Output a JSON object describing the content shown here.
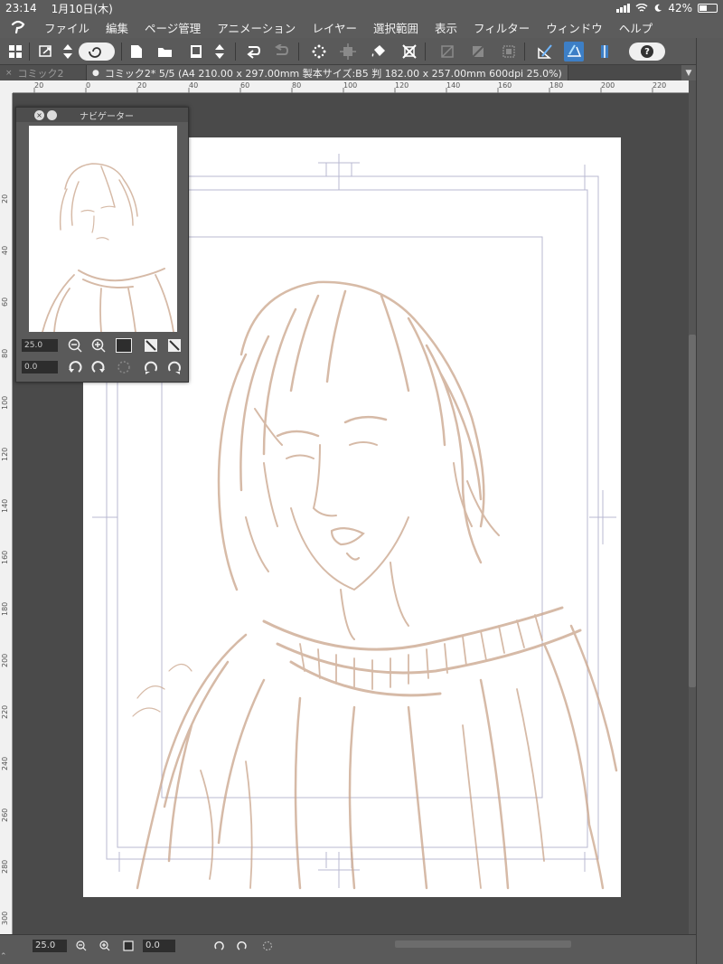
{
  "status": {
    "time": "23:14",
    "date": "1月10日(木)",
    "battery": "42%"
  },
  "menu": [
    "ファイル",
    "編集",
    "ページ管理",
    "アニメーション",
    "レイヤー",
    "選択範囲",
    "表示",
    "フィルター",
    "ウィンドウ",
    "ヘルプ"
  ],
  "tabs": {
    "inactive": "コミック2",
    "active": "コミック2* 5/5 (A4 210.00 x 297.00mm 製本サイズ:B5 判 182.00 x 257.00mm 600dpi 25.0%)"
  },
  "ruler_h": [
    "20",
    "0",
    "20",
    "40",
    "60",
    "80",
    "100",
    "120",
    "140",
    "160",
    "180",
    "200",
    "220"
  ],
  "ruler_v": [
    "20",
    "40",
    "60",
    "80",
    "100",
    "120",
    "140",
    "160",
    "180",
    "200",
    "220",
    "240",
    "260",
    "280",
    "300"
  ],
  "navigator": {
    "title": "ナビゲーター",
    "zoom": "25.0",
    "rotation": "0.0"
  },
  "bottom": {
    "zoom": "25.0",
    "rotation": "0.0"
  },
  "icons": {
    "close": "×",
    "help": "?",
    "collapse": "«"
  },
  "colors": {
    "sketch": "#c9a48a",
    "frame": "#b6b6d6"
  }
}
